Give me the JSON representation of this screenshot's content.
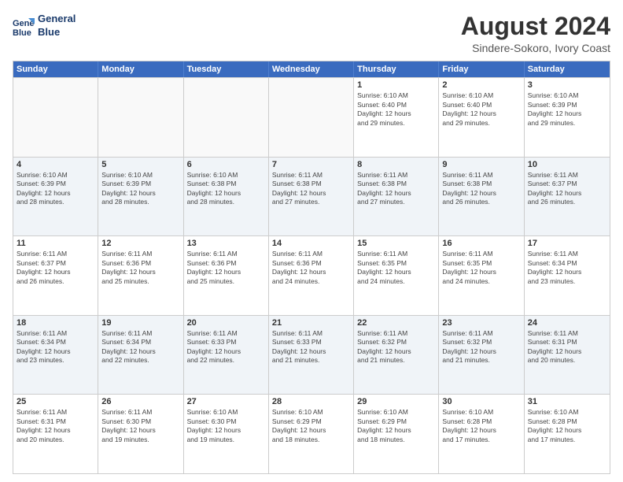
{
  "header": {
    "logo_line1": "General",
    "logo_line2": "Blue",
    "month_year": "August 2024",
    "location": "Sindere-Sokoro, Ivory Coast"
  },
  "weekdays": [
    "Sunday",
    "Monday",
    "Tuesday",
    "Wednesday",
    "Thursday",
    "Friday",
    "Saturday"
  ],
  "rows": [
    [
      {
        "day": "",
        "info": "",
        "empty": true
      },
      {
        "day": "",
        "info": "",
        "empty": true
      },
      {
        "day": "",
        "info": "",
        "empty": true
      },
      {
        "day": "",
        "info": "",
        "empty": true
      },
      {
        "day": "1",
        "info": "Sunrise: 6:10 AM\nSunset: 6:40 PM\nDaylight: 12 hours\nand 29 minutes."
      },
      {
        "day": "2",
        "info": "Sunrise: 6:10 AM\nSunset: 6:40 PM\nDaylight: 12 hours\nand 29 minutes."
      },
      {
        "day": "3",
        "info": "Sunrise: 6:10 AM\nSunset: 6:39 PM\nDaylight: 12 hours\nand 29 minutes."
      }
    ],
    [
      {
        "day": "4",
        "info": "Sunrise: 6:10 AM\nSunset: 6:39 PM\nDaylight: 12 hours\nand 28 minutes."
      },
      {
        "day": "5",
        "info": "Sunrise: 6:10 AM\nSunset: 6:39 PM\nDaylight: 12 hours\nand 28 minutes."
      },
      {
        "day": "6",
        "info": "Sunrise: 6:10 AM\nSunset: 6:38 PM\nDaylight: 12 hours\nand 28 minutes."
      },
      {
        "day": "7",
        "info": "Sunrise: 6:11 AM\nSunset: 6:38 PM\nDaylight: 12 hours\nand 27 minutes."
      },
      {
        "day": "8",
        "info": "Sunrise: 6:11 AM\nSunset: 6:38 PM\nDaylight: 12 hours\nand 27 minutes."
      },
      {
        "day": "9",
        "info": "Sunrise: 6:11 AM\nSunset: 6:38 PM\nDaylight: 12 hours\nand 26 minutes."
      },
      {
        "day": "10",
        "info": "Sunrise: 6:11 AM\nSunset: 6:37 PM\nDaylight: 12 hours\nand 26 minutes."
      }
    ],
    [
      {
        "day": "11",
        "info": "Sunrise: 6:11 AM\nSunset: 6:37 PM\nDaylight: 12 hours\nand 26 minutes."
      },
      {
        "day": "12",
        "info": "Sunrise: 6:11 AM\nSunset: 6:36 PM\nDaylight: 12 hours\nand 25 minutes."
      },
      {
        "day": "13",
        "info": "Sunrise: 6:11 AM\nSunset: 6:36 PM\nDaylight: 12 hours\nand 25 minutes."
      },
      {
        "day": "14",
        "info": "Sunrise: 6:11 AM\nSunset: 6:36 PM\nDaylight: 12 hours\nand 24 minutes."
      },
      {
        "day": "15",
        "info": "Sunrise: 6:11 AM\nSunset: 6:35 PM\nDaylight: 12 hours\nand 24 minutes."
      },
      {
        "day": "16",
        "info": "Sunrise: 6:11 AM\nSunset: 6:35 PM\nDaylight: 12 hours\nand 24 minutes."
      },
      {
        "day": "17",
        "info": "Sunrise: 6:11 AM\nSunset: 6:34 PM\nDaylight: 12 hours\nand 23 minutes."
      }
    ],
    [
      {
        "day": "18",
        "info": "Sunrise: 6:11 AM\nSunset: 6:34 PM\nDaylight: 12 hours\nand 23 minutes."
      },
      {
        "day": "19",
        "info": "Sunrise: 6:11 AM\nSunset: 6:34 PM\nDaylight: 12 hours\nand 22 minutes."
      },
      {
        "day": "20",
        "info": "Sunrise: 6:11 AM\nSunset: 6:33 PM\nDaylight: 12 hours\nand 22 minutes."
      },
      {
        "day": "21",
        "info": "Sunrise: 6:11 AM\nSunset: 6:33 PM\nDaylight: 12 hours\nand 21 minutes."
      },
      {
        "day": "22",
        "info": "Sunrise: 6:11 AM\nSunset: 6:32 PM\nDaylight: 12 hours\nand 21 minutes."
      },
      {
        "day": "23",
        "info": "Sunrise: 6:11 AM\nSunset: 6:32 PM\nDaylight: 12 hours\nand 21 minutes."
      },
      {
        "day": "24",
        "info": "Sunrise: 6:11 AM\nSunset: 6:31 PM\nDaylight: 12 hours\nand 20 minutes."
      }
    ],
    [
      {
        "day": "25",
        "info": "Sunrise: 6:11 AM\nSunset: 6:31 PM\nDaylight: 12 hours\nand 20 minutes."
      },
      {
        "day": "26",
        "info": "Sunrise: 6:11 AM\nSunset: 6:30 PM\nDaylight: 12 hours\nand 19 minutes."
      },
      {
        "day": "27",
        "info": "Sunrise: 6:10 AM\nSunset: 6:30 PM\nDaylight: 12 hours\nand 19 minutes."
      },
      {
        "day": "28",
        "info": "Sunrise: 6:10 AM\nSunset: 6:29 PM\nDaylight: 12 hours\nand 18 minutes."
      },
      {
        "day": "29",
        "info": "Sunrise: 6:10 AM\nSunset: 6:29 PM\nDaylight: 12 hours\nand 18 minutes."
      },
      {
        "day": "30",
        "info": "Sunrise: 6:10 AM\nSunset: 6:28 PM\nDaylight: 12 hours\nand 17 minutes."
      },
      {
        "day": "31",
        "info": "Sunrise: 6:10 AM\nSunset: 6:28 PM\nDaylight: 12 hours\nand 17 minutes."
      }
    ]
  ]
}
